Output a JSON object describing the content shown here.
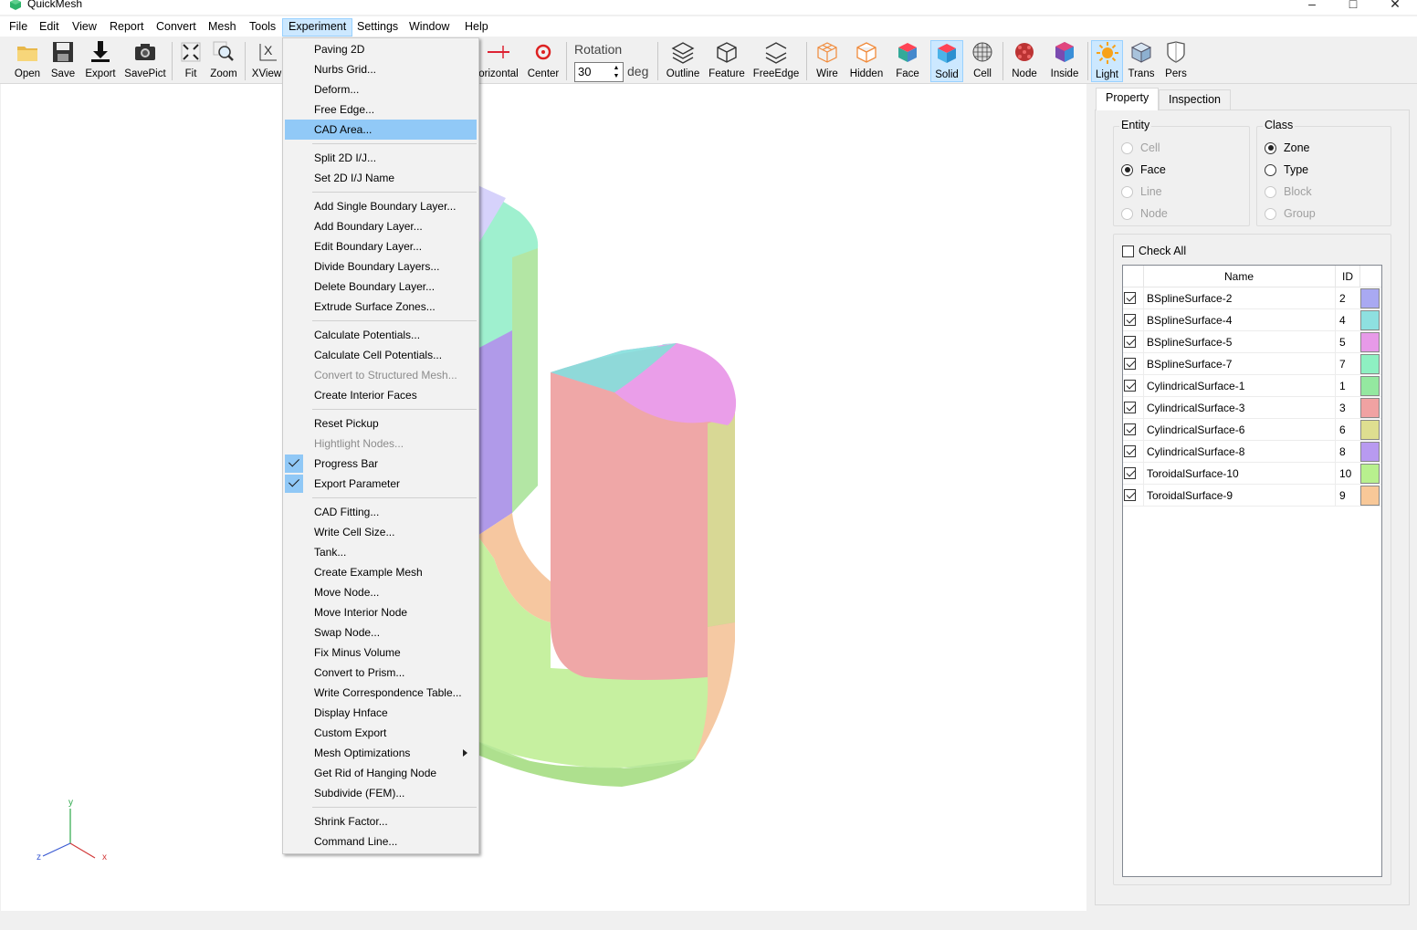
{
  "app": {
    "title": "QuickMesh"
  },
  "menubar": [
    "File",
    "Edit",
    "View",
    "Report",
    "Convert",
    "Mesh",
    "Tools",
    "Experiment",
    "Settings",
    "Window",
    "Help"
  ],
  "toolbar": {
    "open": "Open",
    "save": "Save",
    "export": "Export",
    "savepict": "SavePict",
    "fit": "Fit",
    "zoom": "Zoom",
    "xview": "XView",
    "horizontal": "orizontal",
    "center": "Center",
    "rotation_label": "Rotation",
    "rotation_value": "30",
    "rotation_unit": "deg",
    "outline": "Outline",
    "feature": "Feature",
    "freeedge": "FreeEdge",
    "wire": "Wire",
    "hidden": "Hidden",
    "face": "Face",
    "solid": "Solid",
    "cell": "Cell",
    "node": "Node",
    "inside": "Inside",
    "light": "Light",
    "trans": "Trans",
    "pers": "Pers"
  },
  "experiment_menu": [
    {
      "label": "Paving 2D"
    },
    {
      "label": "Nurbs Grid..."
    },
    {
      "label": "Deform..."
    },
    {
      "label": "Free Edge..."
    },
    {
      "label": "CAD Area...",
      "highlighted": true
    },
    {
      "sep": true
    },
    {
      "label": "Split 2D I/J..."
    },
    {
      "label": "Set 2D I/J Name"
    },
    {
      "sep": true
    },
    {
      "label": "Add Single Boundary Layer..."
    },
    {
      "label": "Add Boundary Layer..."
    },
    {
      "label": "Edit Boundary Layer..."
    },
    {
      "label": "Divide Boundary Layers..."
    },
    {
      "label": "Delete Boundary Layer..."
    },
    {
      "label": "Extrude Surface Zones..."
    },
    {
      "sep": true
    },
    {
      "label": "Calculate Potentials..."
    },
    {
      "label": "Calculate Cell Potentials..."
    },
    {
      "label": "Convert to Structured Mesh...",
      "disabled": true
    },
    {
      "label": "Create Interior Faces"
    },
    {
      "sep": true
    },
    {
      "label": "Reset Pickup"
    },
    {
      "label": "Hightlight Nodes...",
      "disabled": true
    },
    {
      "label": "Progress Bar",
      "checked": true
    },
    {
      "label": "Export Parameter",
      "checked": true
    },
    {
      "sep": true
    },
    {
      "label": "CAD Fitting..."
    },
    {
      "label": "Write Cell Size..."
    },
    {
      "label": "Tank..."
    },
    {
      "label": "Create Example Mesh"
    },
    {
      "label": "Move Node..."
    },
    {
      "label": "Move Interior Node"
    },
    {
      "label": "Swap Node..."
    },
    {
      "label": "Fix Minus Volume"
    },
    {
      "label": "Convert to Prism..."
    },
    {
      "label": "Write Correspondence Table..."
    },
    {
      "label": "Display Hnface"
    },
    {
      "label": "Custom Export"
    },
    {
      "label": "Mesh Optimizations",
      "submenu": true
    },
    {
      "label": "Get Rid of Hanging Node"
    },
    {
      "label": "Subdivide (FEM)..."
    },
    {
      "sep": true
    },
    {
      "label": "Shrink Factor..."
    },
    {
      "label": "Command Line..."
    }
  ],
  "panel": {
    "tabs": [
      "Property",
      "Inspection"
    ],
    "entity_label": "Entity",
    "entity_options": [
      {
        "label": "Cell",
        "enabled": false,
        "selected": false
      },
      {
        "label": "Face",
        "enabled": true,
        "selected": true
      },
      {
        "label": "Line",
        "enabled": false,
        "selected": false
      },
      {
        "label": "Node",
        "enabled": false,
        "selected": false
      }
    ],
    "class_label": "Class",
    "class_options": [
      {
        "label": "Zone",
        "enabled": true,
        "selected": true
      },
      {
        "label": "Type",
        "enabled": true,
        "selected": false
      },
      {
        "label": "Block",
        "enabled": false,
        "selected": false
      },
      {
        "label": "Group",
        "enabled": false,
        "selected": false
      }
    ],
    "check_all": "Check All",
    "col_name": "Name",
    "col_id": "ID",
    "zones": [
      {
        "name": "BSplineSurface-2",
        "id": "2",
        "color": "#a9a9f2"
      },
      {
        "name": "BSplineSurface-4",
        "id": "4",
        "color": "#8ee0e0"
      },
      {
        "name": "BSplineSurface-5",
        "id": "5",
        "color": "#e79ae8"
      },
      {
        "name": "BSplineSurface-7",
        "id": "7",
        "color": "#8ef0c2"
      },
      {
        "name": "CylindricalSurface-1",
        "id": "1",
        "color": "#94e8a0"
      },
      {
        "name": "CylindricalSurface-3",
        "id": "3",
        "color": "#f0a2a2"
      },
      {
        "name": "CylindricalSurface-6",
        "id": "6",
        "color": "#dede90"
      },
      {
        "name": "CylindricalSurface-8",
        "id": "8",
        "color": "#b89af0"
      },
      {
        "name": "ToroidalSurface-10",
        "id": "10",
        "color": "#b8f08e"
      },
      {
        "name": "ToroidalSurface-9",
        "id": "9",
        "color": "#f8c898"
      }
    ]
  },
  "axes": {
    "y": "y",
    "z": "z",
    "x": "x"
  }
}
